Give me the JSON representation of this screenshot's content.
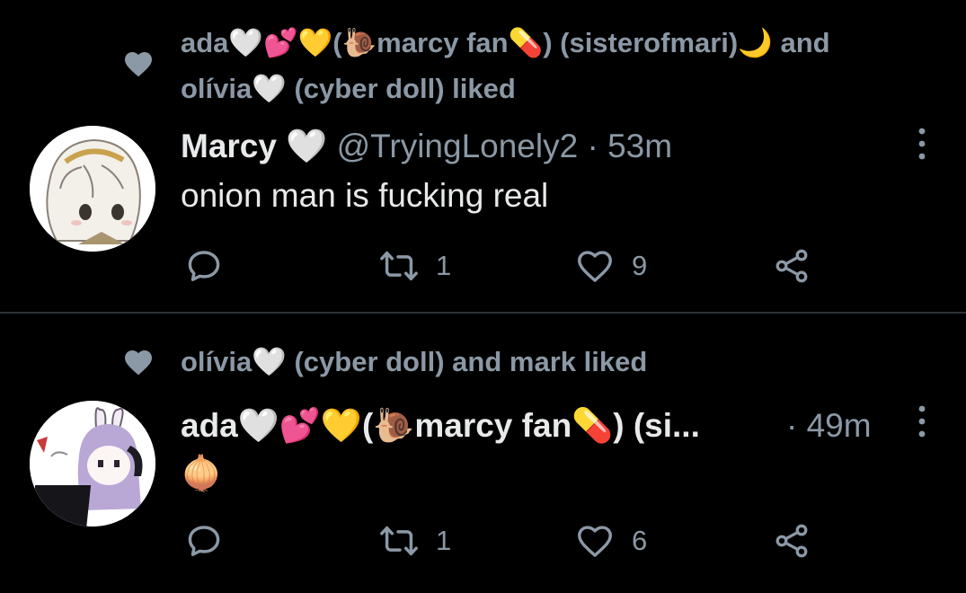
{
  "tweets": [
    {
      "social_context": {
        "line1": "ada🤍💕💛(🐌marcy fan💊) (sisterofmari)🌙 and",
        "line2": "olívia🤍 (cyber doll) liked"
      },
      "author": {
        "name": "Marcy 🤍",
        "handle": "@TryingLonely2"
      },
      "separator": "·",
      "time": "53m",
      "text": "onion man is fucking real",
      "retweets": "1",
      "likes": "9"
    },
    {
      "social_context": {
        "line1": "olívia🤍 (cyber doll) and mark liked"
      },
      "author": {
        "name": "ada🤍💕💛(🐌marcy fan💊) (si..."
      },
      "separator": "·",
      "time": "49m",
      "text": "🧅",
      "retweets": "1",
      "likes": "6"
    }
  ],
  "colors": {
    "background": "#000000",
    "text_primary": "#e7e9ea",
    "text_secondary": "#8b98a5",
    "divider": "#2f3336"
  }
}
